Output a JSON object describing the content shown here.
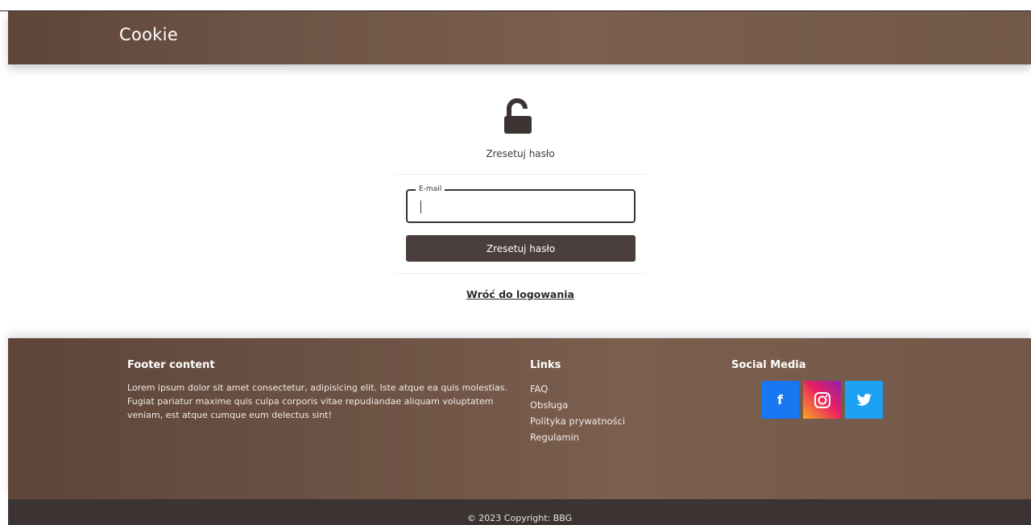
{
  "navbar": {
    "brand": "Cookie"
  },
  "reset": {
    "title": "Zresetuj hasło",
    "email_label": "E-mail",
    "email_value": "",
    "button_label": "Zresetuj hasło",
    "back_link": "Wróć do logowania"
  },
  "footer": {
    "content_title": "Footer content",
    "content_text": "Lorem ipsum dolor sit amet consectetur, adipisicing elit. Iste atque ea quis molestias. Fugiat pariatur maxime quis culpa corporis vitae repudiandae aliquam voluptatem veniam, est atque cumque eum delectus sint!",
    "links_title": "Links",
    "links": [
      "FAQ",
      "Obsługa",
      "Polityka prywatności",
      "Regulamin"
    ],
    "social_title": "Social Media",
    "social": [
      {
        "name": "facebook",
        "glyph": "f"
      },
      {
        "name": "instagram",
        "glyph": "◎"
      },
      {
        "name": "twitter",
        "glyph": "🐦"
      }
    ]
  },
  "copyright": "© 2023 Copyright: BBG",
  "colors": {
    "brand_brown": "#73594a",
    "button_dark": "#4a3f3c",
    "footer_bar": "#3b3432",
    "facebook": "#1877f2",
    "twitter": "#1da1f2"
  }
}
